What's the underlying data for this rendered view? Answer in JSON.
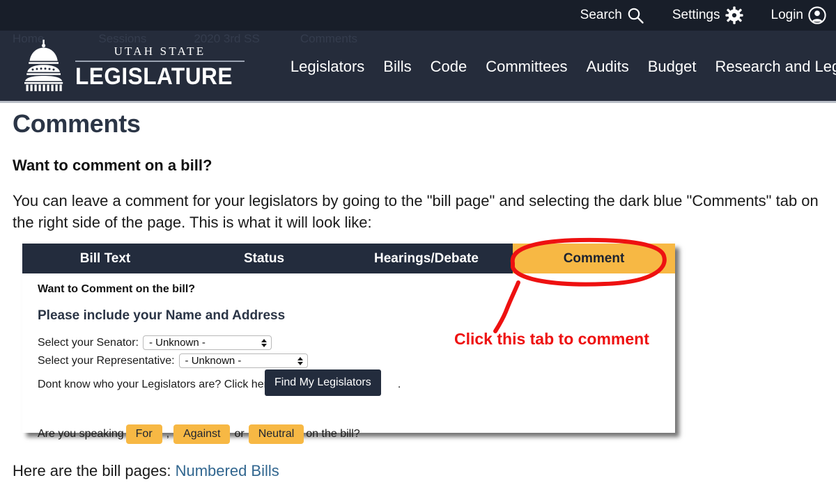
{
  "topbar": {
    "items": [
      {
        "label": "Search",
        "icon": "search-icon"
      },
      {
        "label": "Settings",
        "icon": "gear-icon"
      },
      {
        "label": "Login",
        "icon": "user-avatar-icon"
      }
    ]
  },
  "breadcrumb": {
    "items": [
      "Home",
      "Sessions",
      "2020 3rd SS",
      "Comments"
    ]
  },
  "header": {
    "logo": {
      "top_text": "UTAH STATE",
      "bottom_text": "LEGISLATURE",
      "icon": "capitol-dome-icon"
    },
    "nav": [
      "Legislators",
      "Bills",
      "Code",
      "Committees",
      "Audits",
      "Budget",
      "Research and Legal"
    ]
  },
  "main": {
    "page_title": "Comments",
    "subheading": "Want to comment on a bill?",
    "paragraph": "You can leave a comment for your legislators by going to the \"bill page\" and selecting the dark blue \"Comments\" tab on the right side of the page. This is what it will look like:",
    "closing_prefix": "Here are the bill pages:",
    "closing_link": "Numbered Bills"
  },
  "screenshot": {
    "tabs": [
      {
        "label": "Bill Text",
        "active": false
      },
      {
        "label": "Status",
        "active": false
      },
      {
        "label": "Hearings/Debate",
        "active": false
      },
      {
        "label": "Comment",
        "active": true
      }
    ],
    "prompt": "Want to Comment on the bill?",
    "instruction": "Please include your Name and Address",
    "fields": [
      {
        "label": "Select your Senator:",
        "value": "- Unknown -"
      },
      {
        "label": "Select your Representative:",
        "value": "- Unknown -"
      }
    ],
    "hint_text": "Dont know who your Legislators are? Click here",
    "hint_button": "Find My Legislators",
    "hint_period": ".",
    "speak_prefix": "Are you speaking",
    "speak_options": [
      "For",
      "Against",
      "Neutral"
    ],
    "speak_comma": ",",
    "speak_or": "or",
    "speak_suffix": "on the bill?"
  },
  "annotation": {
    "text": "Click this tab to comment",
    "color": "#ee1111"
  },
  "colors": {
    "topbar_bg": "#181e29",
    "header_bg": "#252c3b",
    "accent_amber": "#f7b844",
    "link_blue": "#31668f",
    "tabbar_bg": "#232c3d"
  }
}
